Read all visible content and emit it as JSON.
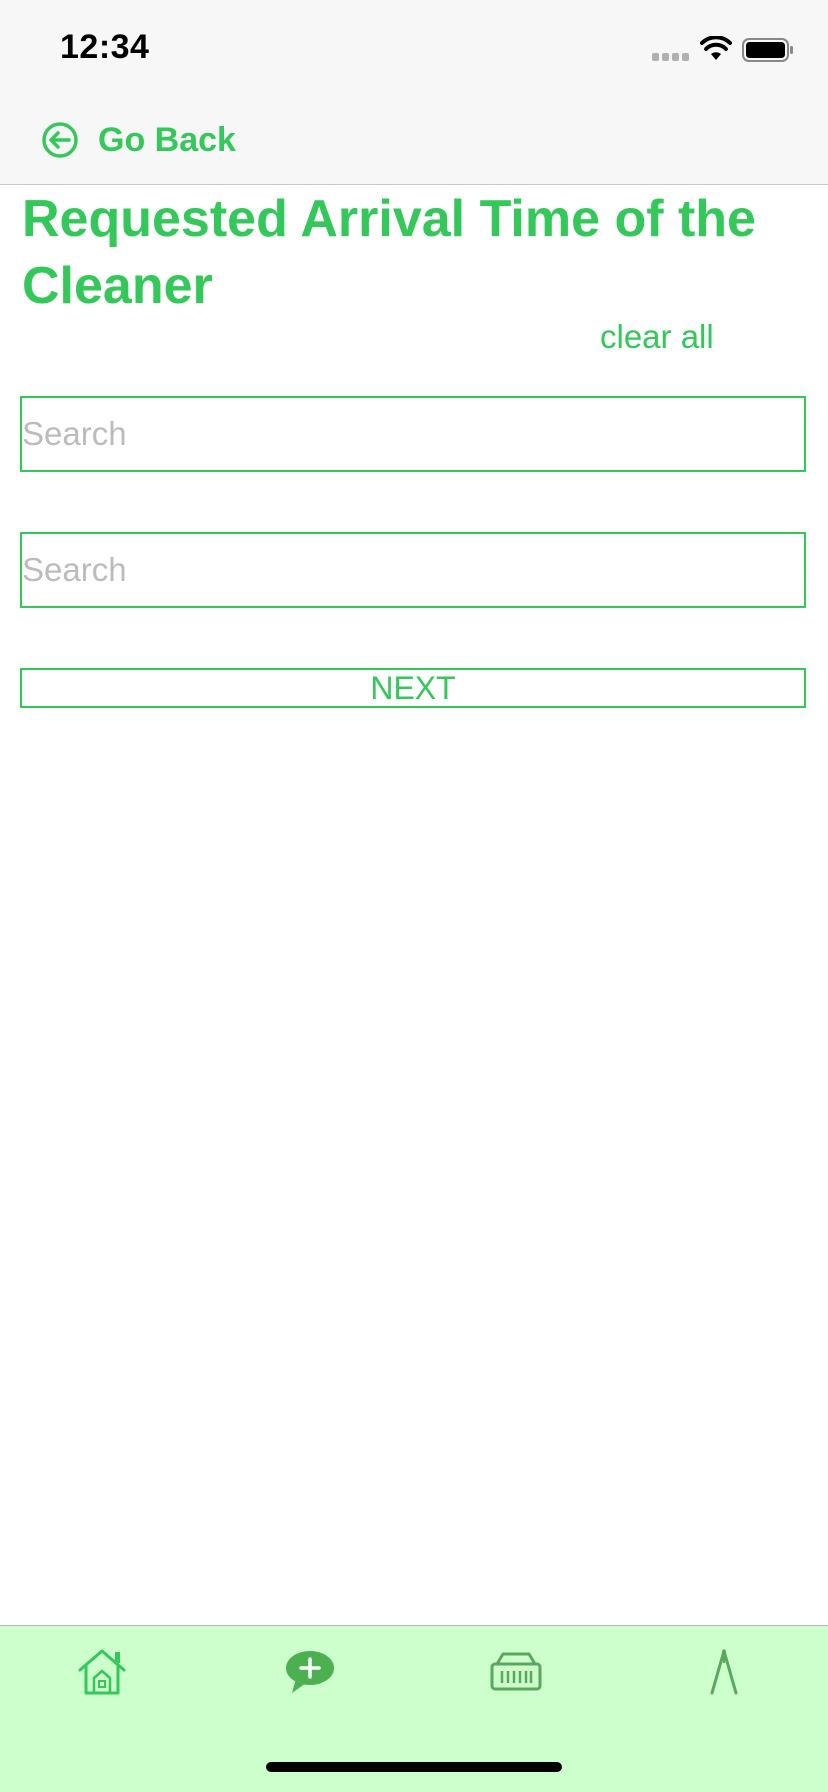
{
  "status_bar": {
    "time": "12:34"
  },
  "nav": {
    "back_label": "Go Back",
    "back_icon": "circle-arrow-left-icon"
  },
  "page": {
    "title": "Requested Arrival Time of the Cleaner",
    "clear_all_label": "clear all"
  },
  "form": {
    "search_1": {
      "value": "",
      "placeholder": "Search"
    },
    "search_2": {
      "value": "",
      "placeholder": "Search"
    },
    "next_label": "NEXT"
  },
  "tab_bar": {
    "items": [
      {
        "icon": "home-icon"
      },
      {
        "icon": "chat-add-icon"
      },
      {
        "icon": "store-icon"
      },
      {
        "icon": "compass-icon"
      }
    ]
  },
  "colors": {
    "accent": "#34c759",
    "tab_bar_background": "#ccffcc",
    "placeholder": "#bcbcbc"
  }
}
